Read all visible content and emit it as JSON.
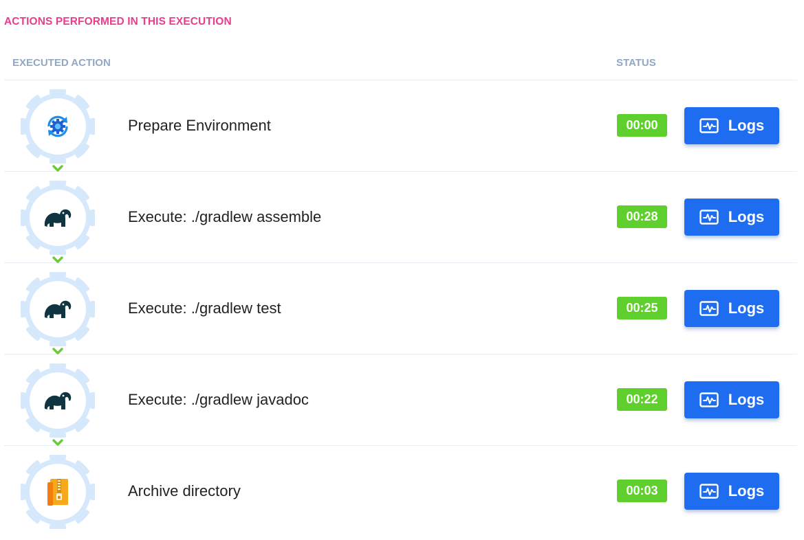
{
  "section_title": "ACTIONS PERFORMED IN THIS EXECUTION",
  "columns": {
    "action": "EXECUTED ACTION",
    "status": "STATUS"
  },
  "colors": {
    "title": "#e83e8c",
    "header": "#93a7c2",
    "status_badge": "#5fcf2d",
    "logs_button": "#1e6cf0",
    "gear": "#d6e8fb",
    "chevron": "#6cc93a"
  },
  "rows": [
    {
      "icon": "settings-sync-icon",
      "label": "Prepare Environment",
      "duration": "00:00",
      "logs_label": "Logs"
    },
    {
      "icon": "gradle-elephant-icon",
      "label": "Execute: ./gradlew assemble",
      "duration": "00:28",
      "logs_label": "Logs"
    },
    {
      "icon": "gradle-elephant-icon",
      "label": "Execute: ./gradlew test",
      "duration": "00:25",
      "logs_label": "Logs"
    },
    {
      "icon": "gradle-elephant-icon",
      "label": "Execute: ./gradlew javadoc",
      "duration": "00:22",
      "logs_label": "Logs"
    },
    {
      "icon": "archive-zip-icon",
      "label": "Archive directory",
      "duration": "00:03",
      "logs_label": "Logs"
    }
  ]
}
